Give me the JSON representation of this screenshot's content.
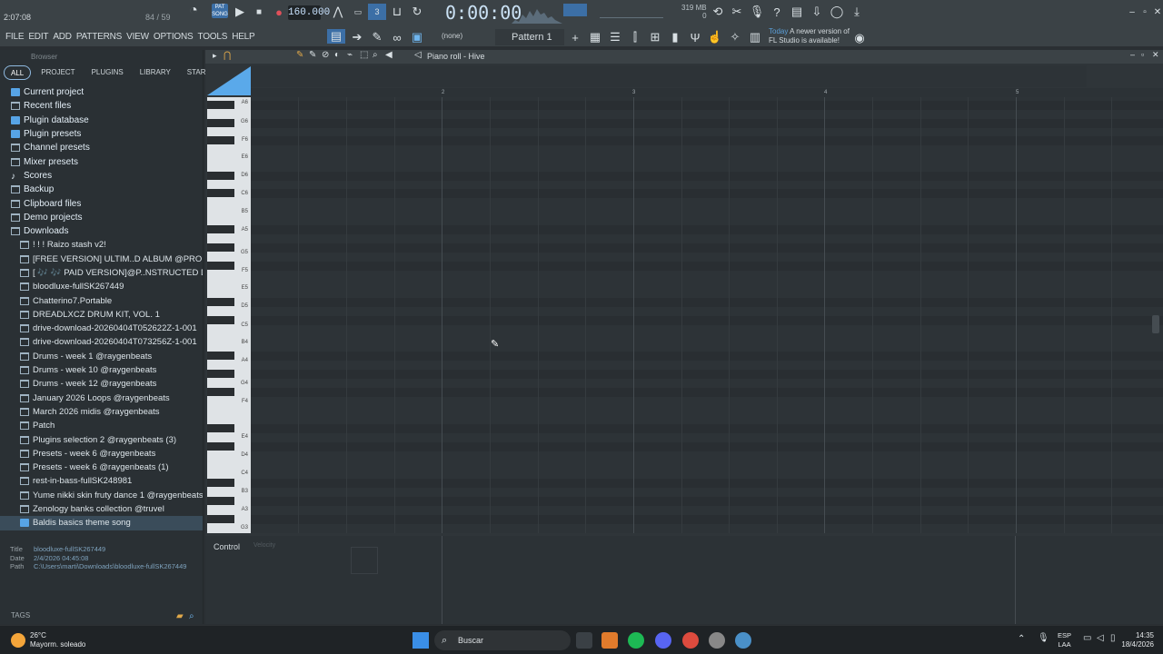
{
  "topbar": {
    "time": "2:07:08",
    "ratio": "84 / 59",
    "tempo": "160.000",
    "song_mode_label": "PAT SONG",
    "timecode": "0:00:00",
    "memory_line1": "319 MB",
    "memory_line2": "0",
    "pattern_name": "Pattern 1",
    "none_selector": "(none)",
    "news_date": "Today",
    "news_text_1": "A newer version of",
    "news_text_2": "FL Studio is available!"
  },
  "menubar": [
    "FILE",
    "EDIT",
    "ADD",
    "PATTERNS",
    "VIEW",
    "OPTIONS",
    "TOOLS",
    "HELP"
  ],
  "browser": {
    "title": "Browser",
    "tabs": [
      "ALL",
      "PROJECT",
      "PLUGINS",
      "LIBRARY",
      "STARRED"
    ],
    "top_items": [
      "Current project",
      "Recent files",
      "Plugin database",
      "Plugin presets",
      "Channel presets",
      "Mixer presets",
      "Scores",
      "Backup",
      "Clipboard files",
      "Demo projects",
      "Downloads"
    ],
    "download_items": [
      "! ! ! Raizo stash v2!",
      "[FREE VERSION] ULTIM..D ALBUM @PROD.ROSEYY$",
      "[ 🎶 🎶 PAID VERSION]@P..NSTRUCTED DRUM KIT",
      "bloodluxe-fullSK267449",
      "Chatterino7.Portable",
      "DREADLXCZ DRUM KIT, VOL. 1",
      "drive-download-20260404T052622Z-1-001",
      "drive-download-20260404T073256Z-1-001",
      "Drums - week 1 @raygenbeats",
      "Drums - week 10 @raygenbeats",
      "Drums - week 12 @raygenbeats",
      "January 2026 Loops @raygenbeats",
      "March 2026 midis @raygenbeats",
      "Patch",
      "Plugins selection 2 @raygenbeats (3)",
      "Presets - week 6 @raygenbeats",
      "Presets - week 6 @raygenbeats (1)",
      "rest-in-bass-fullSK248981",
      "Yume nikki skin fruty dance 1 @raygenbeats",
      "Zenology banks collection @truvel",
      "Baldis basics theme song"
    ],
    "meta": {
      "title_label": "Title",
      "title_value": "bloodluxe-fullSK267449",
      "date_label": "Date",
      "date_value": "2/4/2026 04:45:08",
      "path_label": "Path",
      "path_value": "C:\\Users\\marti\\Downloads\\bloodluxe-fullSK267449"
    },
    "tags_label": "TAGS"
  },
  "pianoroll": {
    "title": "Piano roll - Hive",
    "bar_numbers": [
      "2",
      "3",
      "4",
      "5"
    ],
    "key_labels": [
      "A6",
      "G6",
      "F6",
      "E6",
      "D6",
      "C6",
      "B5",
      "A5",
      "G5",
      "F5",
      "E5",
      "D5",
      "C5",
      "B4",
      "A4",
      "G4",
      "F4",
      "E4",
      "D4",
      "C4",
      "B3",
      "A3",
      "G3"
    ],
    "control_label": "Control",
    "control_param": "Velocity"
  },
  "taskbar": {
    "temperature": "26°C",
    "weather": "Mayorm. soleado",
    "search_placeholder": "Buscar",
    "lang_1": "ESP",
    "lang_2": "LAA",
    "clock_time": "14:35",
    "clock_date": "18/4/2026"
  }
}
